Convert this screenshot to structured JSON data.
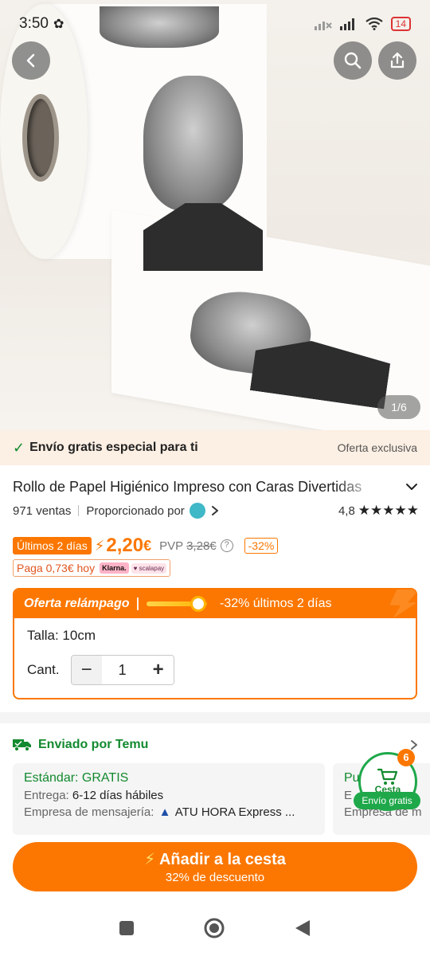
{
  "status_bar": {
    "time": "3:50",
    "battery": "14"
  },
  "gallery": {
    "counter": "1/6"
  },
  "shipping_banner": {
    "text": "Envío gratis especial para ti",
    "offer": "Oferta exclusiva"
  },
  "product": {
    "title": "Rollo de Papel Higiénico Impreso con Caras Divertidas",
    "sales": "971 ventas",
    "provided_by": "Proporcionado por",
    "rating": "4,8",
    "stars": "★★★★★"
  },
  "price": {
    "days_badge": "Últimos 2 días",
    "current": "2,20",
    "currency": "€",
    "pvp_label": "PVP",
    "old_price": "3,28€",
    "discount": "-32%",
    "pay_today": "Paga 0,73€ hoy",
    "klarna": "Klarna.",
    "scalapay": "♥ scalapay"
  },
  "flash_deal": {
    "title": "Oferta relámpago",
    "text": "-32% últimos 2 días",
    "progress": 0.85,
    "size_label": "Talla: 10cm",
    "qty_label": "Cant.",
    "qty_value": "1",
    "minus": "−",
    "plus": "+"
  },
  "shipping": {
    "sent_by": "Enviado por Temu",
    "standard": "Estándar: GRATIS",
    "delivery_label": "Entrega:",
    "delivery_value": "6-12 días hábiles",
    "courier_label": "Empresa de mensajería:",
    "courier_value": "ATU HORA Express ...",
    "card2_title": "Pu",
    "card2_line1": "E",
    "card2_line2": "Empresa de m"
  },
  "cart": {
    "label": "Cesta",
    "count": "6",
    "free_shipping": "Envío gratis"
  },
  "add_to_cart": {
    "label": "Añadir a la cesta",
    "sub": "32% de descuento"
  },
  "colors": {
    "accent": "#fb7701",
    "green": "#138a2f"
  }
}
